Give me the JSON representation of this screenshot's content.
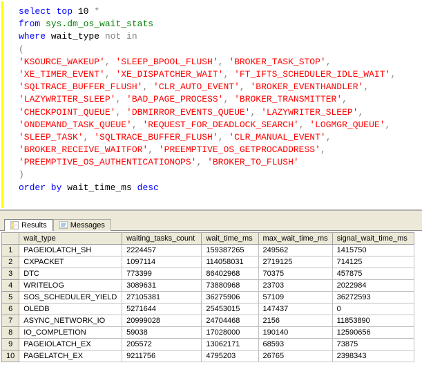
{
  "query": {
    "lines": [
      [
        [
          "kw",
          "select"
        ],
        [
          "plain",
          " "
        ],
        [
          "kw",
          "top"
        ],
        [
          "plain",
          " 10 "
        ],
        [
          "op",
          "*"
        ]
      ],
      [
        [
          "kw",
          "from"
        ],
        [
          "plain",
          " "
        ],
        [
          "obj",
          "sys.dm_os_wait_stats"
        ]
      ],
      [
        [
          "kw",
          "where"
        ],
        [
          "plain",
          " wait_type "
        ],
        [
          "op",
          "not in"
        ]
      ],
      [
        [
          "op",
          "("
        ]
      ],
      [
        [
          "str",
          "'KSOURCE_WAKEUP'"
        ],
        [
          "op",
          ", "
        ],
        [
          "str",
          "'SLEEP_BPOOL_FLUSH'"
        ],
        [
          "op",
          ", "
        ],
        [
          "str",
          "'BROKER_TASK_STOP'"
        ],
        [
          "op",
          ","
        ]
      ],
      [
        [
          "str",
          "'XE_TIMER_EVENT'"
        ],
        [
          "op",
          ", "
        ],
        [
          "str",
          "'XE_DISPATCHER_WAIT'"
        ],
        [
          "op",
          ", "
        ],
        [
          "str",
          "'FT_IFTS_SCHEDULER_IDLE_WAIT'"
        ],
        [
          "op",
          ","
        ]
      ],
      [
        [
          "str",
          "'SQLTRACE_BUFFER_FLUSH'"
        ],
        [
          "op",
          ", "
        ],
        [
          "str",
          "'CLR_AUTO_EVENT'"
        ],
        [
          "op",
          ", "
        ],
        [
          "str",
          "'BROKER_EVENTHANDLER'"
        ],
        [
          "op",
          ","
        ]
      ],
      [
        [
          "str",
          "'LAZYWRITER_SLEEP'"
        ],
        [
          "op",
          ", "
        ],
        [
          "str",
          "'BAD_PAGE_PROCESS'"
        ],
        [
          "op",
          ", "
        ],
        [
          "str",
          "'BROKER_TRANSMITTER'"
        ],
        [
          "op",
          ","
        ]
      ],
      [
        [
          "str",
          "'CHECKPOINT_QUEUE'"
        ],
        [
          "op",
          ", "
        ],
        [
          "str",
          "'DBMIRROR_EVENTS_QUEUE'"
        ],
        [
          "op",
          ", "
        ],
        [
          "str",
          "'LAZYWRITER_SLEEP'"
        ],
        [
          "op",
          ","
        ]
      ],
      [
        [
          "str",
          "'ONDEMAND_TASK_QUEUE'"
        ],
        [
          "op",
          ", "
        ],
        [
          "str",
          "'REQUEST_FOR_DEADLOCK_SEARCH'"
        ],
        [
          "op",
          ", "
        ],
        [
          "str",
          "'LOGMGR_QUEUE'"
        ],
        [
          "op",
          ","
        ]
      ],
      [
        [
          "str",
          "'SLEEP_TASK'"
        ],
        [
          "op",
          ", "
        ],
        [
          "str",
          "'SQLTRACE_BUFFER_FLUSH'"
        ],
        [
          "op",
          ", "
        ],
        [
          "str",
          "'CLR_MANUAL_EVENT'"
        ],
        [
          "op",
          ","
        ]
      ],
      [
        [
          "str",
          "'BROKER_RECEIVE_WAITFOR'"
        ],
        [
          "op",
          ", "
        ],
        [
          "str",
          "'PREEMPTIVE_OS_GETPROCADDRESS'"
        ],
        [
          "op",
          ","
        ]
      ],
      [
        [
          "str",
          "'PREEMPTIVE_OS_AUTHENTICATIONOPS'"
        ],
        [
          "op",
          ", "
        ],
        [
          "str",
          "'BROKER_TO_FLUSH'"
        ]
      ],
      [
        [
          "op",
          ")"
        ]
      ],
      [
        [
          "kw",
          "order by"
        ],
        [
          "plain",
          " wait_time_ms "
        ],
        [
          "kw",
          "desc"
        ]
      ]
    ]
  },
  "tabs": {
    "results": "Results",
    "messages": "Messages"
  },
  "grid": {
    "headers": [
      "wait_type",
      "waiting_tasks_count",
      "wait_time_ms",
      "max_wait_time_ms",
      "signal_wait_time_ms"
    ],
    "rows": [
      {
        "n": "1",
        "wait_type": "PAGEIOLATCH_SH",
        "waiting_tasks_count": "2224457",
        "wait_time_ms": "159387265",
        "max_wait_time_ms": "249562",
        "signal_wait_time_ms": "1415750"
      },
      {
        "n": "2",
        "wait_type": "CXPACKET",
        "waiting_tasks_count": "1097114",
        "wait_time_ms": "114058031",
        "max_wait_time_ms": "2719125",
        "signal_wait_time_ms": "714125"
      },
      {
        "n": "3",
        "wait_type": "DTC",
        "waiting_tasks_count": "773399",
        "wait_time_ms": "86402968",
        "max_wait_time_ms": "70375",
        "signal_wait_time_ms": "457875"
      },
      {
        "n": "4",
        "wait_type": "WRITELOG",
        "waiting_tasks_count": "3089631",
        "wait_time_ms": "73880968",
        "max_wait_time_ms": "23703",
        "signal_wait_time_ms": "2022984"
      },
      {
        "n": "5",
        "wait_type": "SOS_SCHEDULER_YIELD",
        "waiting_tasks_count": "27105381",
        "wait_time_ms": "36275906",
        "max_wait_time_ms": "57109",
        "signal_wait_time_ms": "36272593"
      },
      {
        "n": "6",
        "wait_type": "OLEDB",
        "waiting_tasks_count": "5271644",
        "wait_time_ms": "25453015",
        "max_wait_time_ms": "147437",
        "signal_wait_time_ms": "0"
      },
      {
        "n": "7",
        "wait_type": "ASYNC_NETWORK_IO",
        "waiting_tasks_count": "20999028",
        "wait_time_ms": "24704468",
        "max_wait_time_ms": "2156",
        "signal_wait_time_ms": "11853890"
      },
      {
        "n": "8",
        "wait_type": "IO_COMPLETION",
        "waiting_tasks_count": "59038",
        "wait_time_ms": "17028000",
        "max_wait_time_ms": "190140",
        "signal_wait_time_ms": "12590656"
      },
      {
        "n": "9",
        "wait_type": "PAGEIOLATCH_EX",
        "waiting_tasks_count": "205572",
        "wait_time_ms": "13062171",
        "max_wait_time_ms": "68593",
        "signal_wait_time_ms": "73875"
      },
      {
        "n": "10",
        "wait_type": "PAGELATCH_EX",
        "waiting_tasks_count": "9211756",
        "wait_time_ms": "4795203",
        "max_wait_time_ms": "26765",
        "signal_wait_time_ms": "2398343"
      }
    ]
  }
}
